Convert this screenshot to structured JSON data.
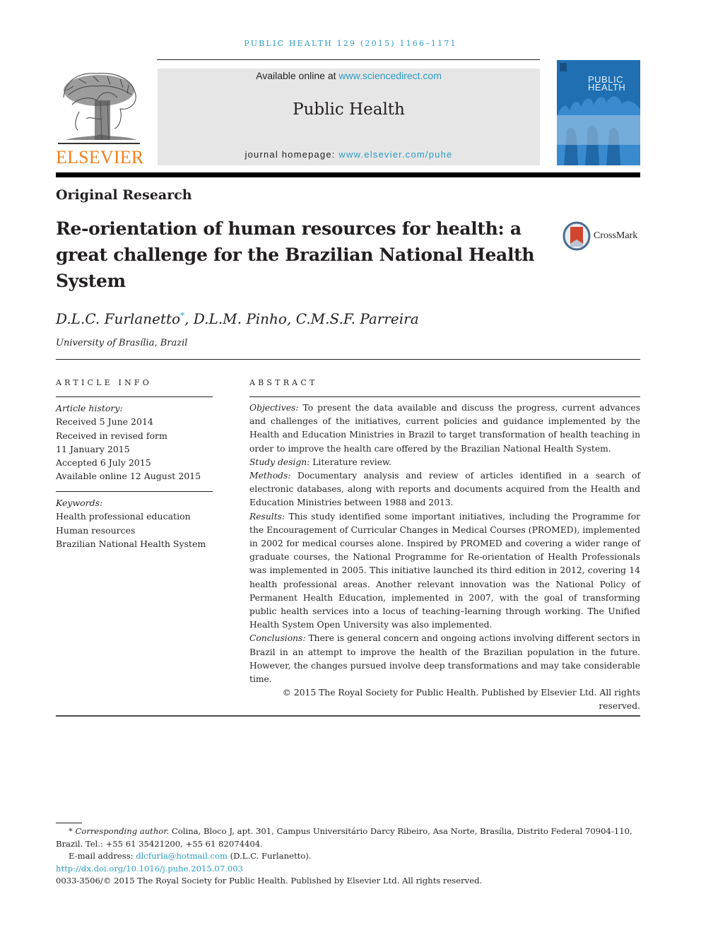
{
  "running_head": "PUBLIC HEALTH 129 (2015) 1166–1171",
  "publisher": {
    "logo_word": "ELSEVIER",
    "logo_icon": "elsevier-tree-icon",
    "brand_color": "#f07f1a"
  },
  "banner": {
    "available_prefix": "Available online at ",
    "available_link": "www.sciencedirect.com",
    "journal_name": "Public Health",
    "homepage_prefix": "journal homepage: ",
    "homepage_link": "www.elsevier.com/puhe",
    "link_color": "#2a9bc3"
  },
  "cover": {
    "title_line1": "PUBLIC",
    "title_line2": "HEALTH",
    "color": "#1f6fb2"
  },
  "article": {
    "section": "Original Research",
    "title": "Re-orientation of human resources for health: a great challenge for the Brazilian National Health System",
    "crossmark_label": "CrossMark",
    "authors_first": "D.L.C. Furlanetto",
    "corresponding_mark": "*",
    "authors_rest": ", D.L.M. Pinho, C.M.S.F. Parreira",
    "affiliation": "University of Brasília, Brazil"
  },
  "article_info": {
    "heading": "ARTICLE INFO",
    "history_label": "Article history:",
    "history": [
      "Received 5 June 2014",
      "Received in revised form",
      "11 January 2015",
      "Accepted 6 July 2015",
      "Available online 12 August 2015"
    ],
    "keywords_label": "Keywords:",
    "keywords": [
      "Health professional education",
      "Human resources",
      "Brazilian National Health System"
    ]
  },
  "abstract": {
    "heading": "ABSTRACT",
    "sections": [
      {
        "label": "Objectives:",
        "text": " To present the data available and discuss the progress, current advances and challenges of the initiatives, current policies and guidance implemented by the Health and Education Ministries in Brazil to target transformation of health teaching in order to improve the health care offered by the Brazilian National Health System."
      },
      {
        "label": "Study design:",
        "text": " Literature review."
      },
      {
        "label": "Methods:",
        "text": " Documentary analysis and review of articles identified in a search of electronic databases, along with reports and documents acquired from the Health and Education Ministries between 1988 and 2013."
      },
      {
        "label": "Results:",
        "text": " This study identified some important initiatives, including the Programme for the Encouragement of Curricular Changes in Medical Courses (PROMED), implemented in 2002 for medical courses alone. Inspired by PROMED and covering a wider range of graduate courses, the National Programme for Re-orientation of Health Professionals was implemented in 2005. This initiative launched its third edition in 2012, covering 14 health professional areas. Another relevant innovation was the National Policy of Permanent Health Education, implemented in 2007, with the goal of transforming public health services into a locus of teaching–learning through working. The Unified Health System Open University was also implemented."
      },
      {
        "label": "Conclusions:",
        "text": " There is general concern and ongoing actions involving different sectors in Brazil in an attempt to improve the health of the Brazilian population in the future. However, the changes pursued involve deep transformations and may take considerable time."
      }
    ],
    "copyright": "© 2015 The Royal Society for Public Health. Published by Elsevier Ltd. All rights reserved."
  },
  "footnotes": {
    "corresponding_mark": "*",
    "corresponding_label": "Corresponding author.",
    "corresponding_text": " Colina, Bloco J, apt. 301, Campus Universitário Darcy Ribeiro, Asa Norte, Brasília, Distrito Federal 70904-110, Brazil. Tel.: +55 61 35421200, +55 61 82074404.",
    "email_prefix": "E-mail address: ",
    "email": "dlcfurla@hotmail.com",
    "email_suffix": " (D.L.C. Furlanetto).",
    "doi": "http://dx.doi.org/10.1016/j.puhe.2015.07.003",
    "issn_line": "0033-3506/© 2015 The Royal Society for Public Health. Published by Elsevier Ltd. All rights reserved."
  }
}
